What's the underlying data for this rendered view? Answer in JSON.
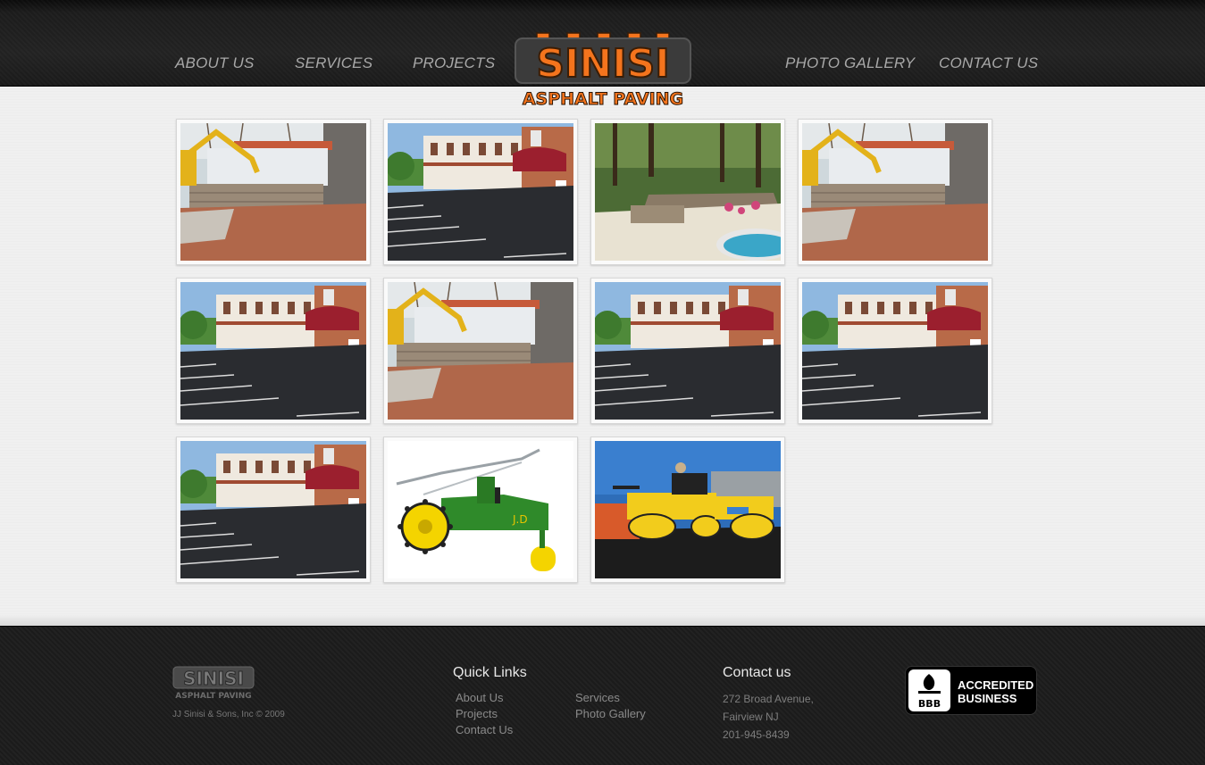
{
  "nav": {
    "about": "ABOUT US",
    "services": "SERVICES",
    "projects": "PROJECTS",
    "gallery": "PHOTO GALLERY",
    "contact": "CONTACT US"
  },
  "logo": {
    "name": "SINISI",
    "tagline": "ASPHALT PAVING"
  },
  "gallery": [
    {
      "scene": "excavation"
    },
    {
      "scene": "motel"
    },
    {
      "scene": "patio-pool"
    },
    {
      "scene": "excavation"
    },
    {
      "scene": "motel"
    },
    {
      "scene": "excavation"
    },
    {
      "scene": "motel"
    },
    {
      "scene": "motel"
    },
    {
      "scene": "motel"
    },
    {
      "scene": "toy-tractor"
    },
    {
      "scene": "road-rollers"
    }
  ],
  "footer": {
    "copyright": "JJ Sinisi & Sons, Inc © 2009",
    "quick_links": {
      "heading": "Quick Links",
      "about": "About Us",
      "projects": "Projects",
      "contact": "Contact Us",
      "services": "Services",
      "gallery": "Photo Gallery"
    },
    "contact": {
      "heading": "Contact us",
      "address1": "272 Broad Avenue,",
      "address2": "Fairview NJ",
      "phone": "201-945-8439"
    },
    "bbb": {
      "line1": "ACCREDITED",
      "line2": "BUSINESS",
      "seal": "BBB"
    }
  },
  "colors": {
    "logo_orange": "#f4741d",
    "header_bg": "#1c1c1c",
    "footer_bg": "#1b1b1b"
  }
}
